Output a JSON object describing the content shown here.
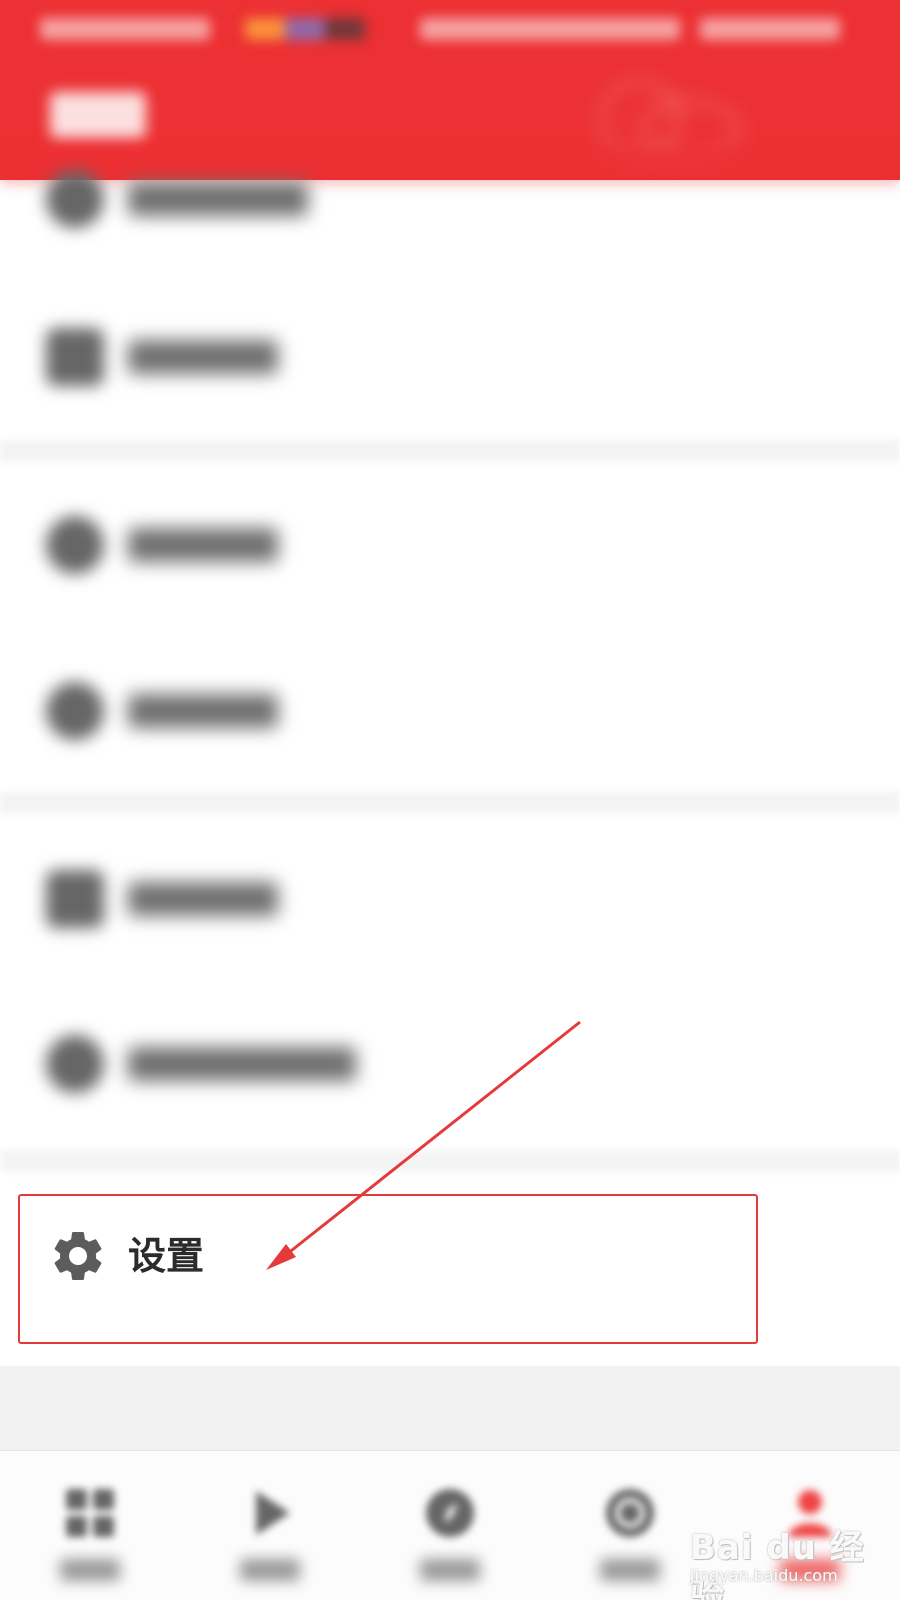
{
  "settings": {
    "label": "设置"
  },
  "watermark": {
    "main": "Bai du 经验",
    "sub": "jingyan.baidu.com"
  },
  "colors": {
    "header": "#ec3033",
    "annotation": "#e53a3a",
    "settings_icon": "#5c5c5c"
  },
  "icons": {
    "settings": "gear-icon",
    "tabs": [
      "grid-icon",
      "play-icon",
      "compass-icon",
      "record-icon",
      "person-icon"
    ]
  }
}
